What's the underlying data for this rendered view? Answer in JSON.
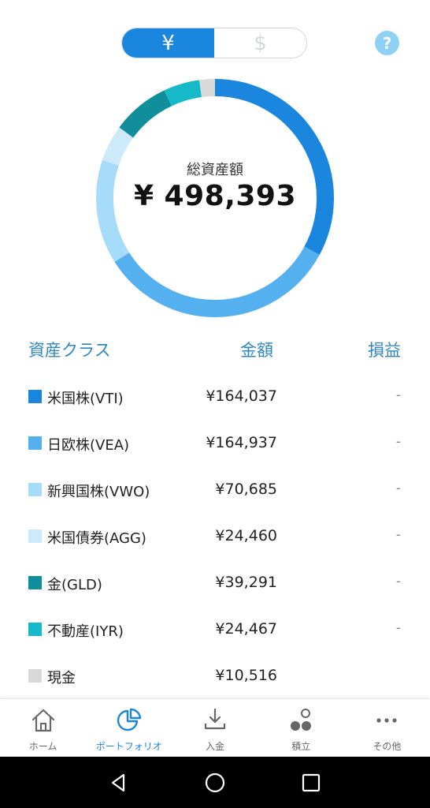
{
  "currency_toggle": {
    "yen_label": "¥",
    "dollar_label": "$"
  },
  "help": {
    "label": "?"
  },
  "summary": {
    "label": "総資産額",
    "value": "¥ 498,393"
  },
  "table": {
    "headers": {
      "asset_class": "資産クラス",
      "amount": "金額",
      "pl": "損益"
    },
    "rows": [
      {
        "name": "米国株(VTI)",
        "amount": "¥164,037",
        "pl": "-",
        "color": "#1a86de",
        "value": 164037
      },
      {
        "name": "日欧株(VEA)",
        "amount": "¥164,937",
        "pl": "-",
        "color": "#55b0f0",
        "value": 164937
      },
      {
        "name": "新興国株(VWO)",
        "amount": "¥70,685",
        "pl": "-",
        "color": "#a6dcfa",
        "value": 70685
      },
      {
        "name": "米国債券(AGG)",
        "amount": "¥24,460",
        "pl": "-",
        "color": "#cdeafb",
        "value": 24460
      },
      {
        "name": "金(GLD)",
        "amount": "¥39,291",
        "pl": "-",
        "color": "#118e9c",
        "value": 39291
      },
      {
        "name": "不動産(IYR)",
        "amount": "¥24,467",
        "pl": "-",
        "color": "#16b9c8",
        "value": 24467
      },
      {
        "name": "現金",
        "amount": "¥10,516",
        "pl": "",
        "color": "#d9d9d9",
        "value": 10516
      }
    ]
  },
  "nav": {
    "home": "ホーム",
    "portfolio": "ポートフォリオ",
    "deposit": "入金",
    "accumulate": "積立",
    "other": "その他"
  },
  "colors": {
    "accent": "#1a86de",
    "header_text": "#2f86c4"
  }
}
